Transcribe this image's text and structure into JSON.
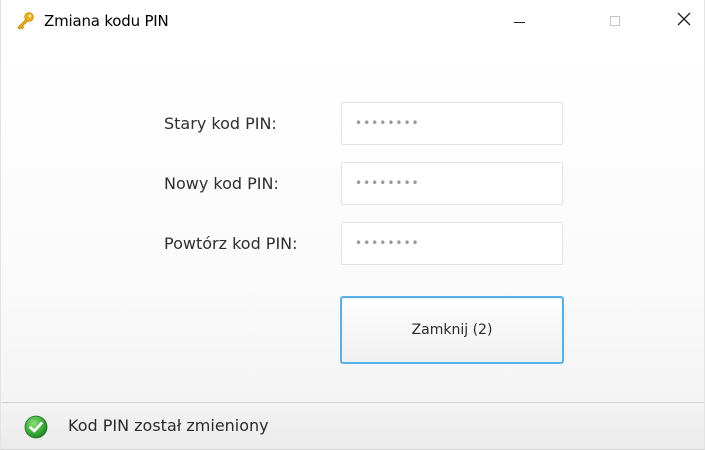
{
  "window": {
    "title": "Zmiana kodu PIN",
    "title_icon": "key-icon",
    "controls": {
      "minimize_icon": "minimize-icon",
      "maximize_icon": "maximize-icon",
      "close_icon": "close-icon"
    }
  },
  "form": {
    "old_pin_label": "Stary kod PIN:",
    "old_pin_value": "••••••••",
    "new_pin_label": "Nowy kod PIN:",
    "new_pin_value": "••••••••",
    "repeat_pin_label": "Powtórz kod PIN:",
    "repeat_pin_value": "••••••••",
    "close_button_label": "Zamknij (2)"
  },
  "status": {
    "icon": "success-check-icon",
    "text": "Kod PIN został zmieniony"
  },
  "colors": {
    "accent_border": "#5ab0e6",
    "success_green": "#3cae3c",
    "key_gold": "#e8a317"
  }
}
